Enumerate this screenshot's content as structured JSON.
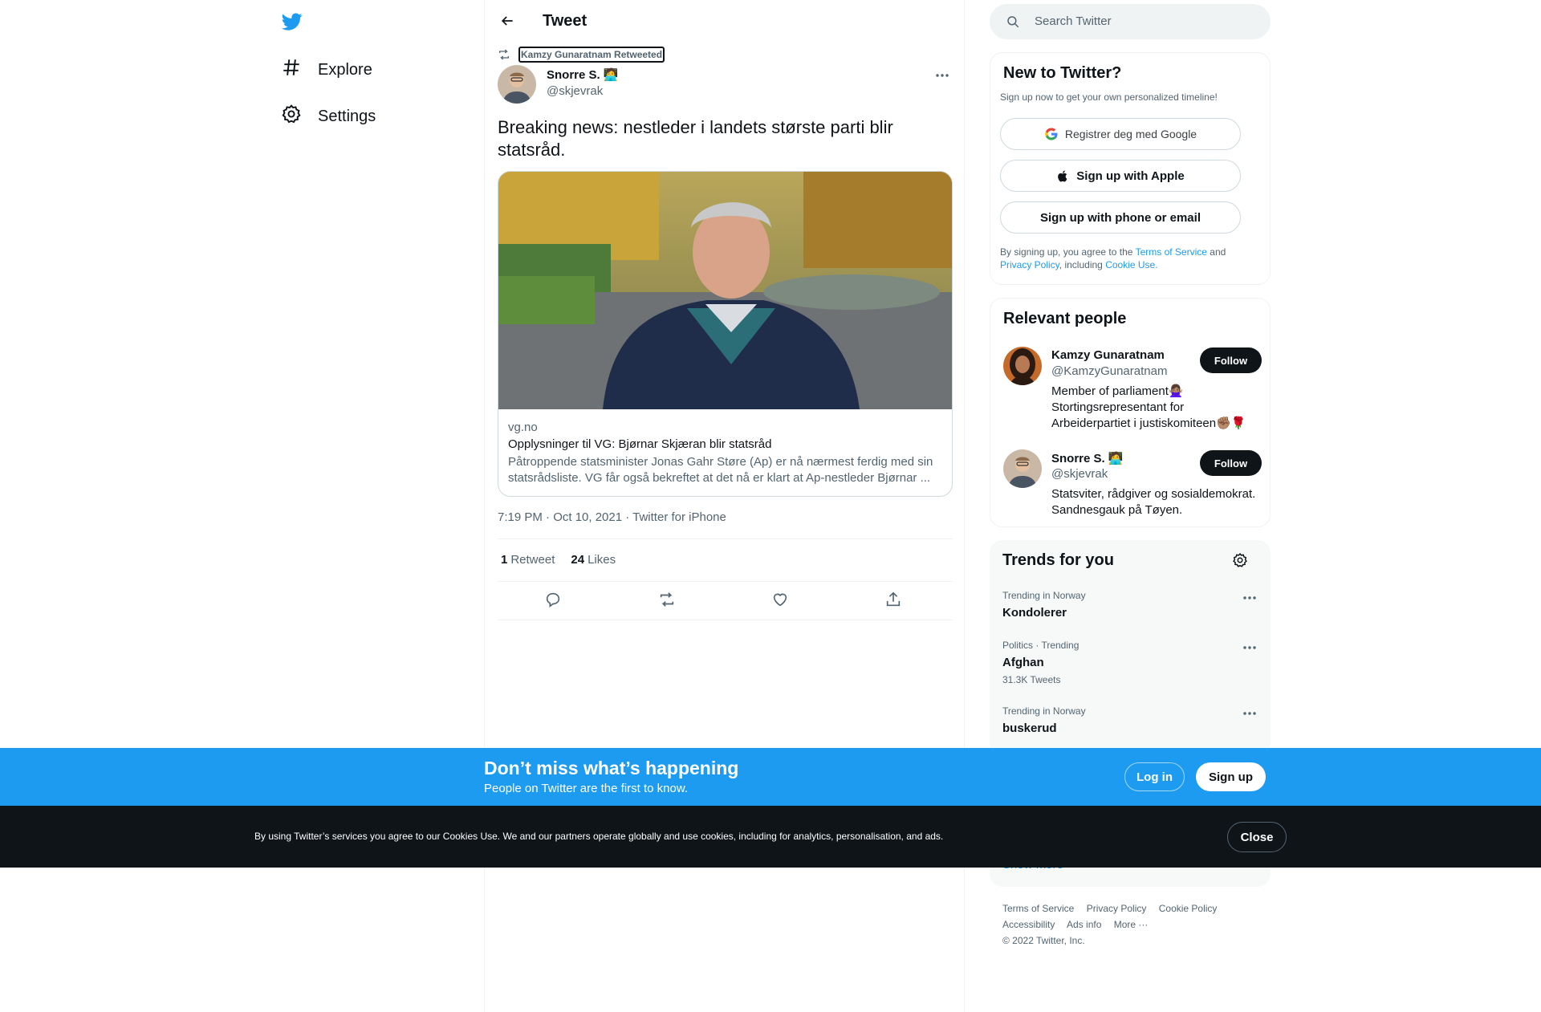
{
  "nav": {
    "items": [
      {
        "label": "Explore",
        "icon": "hashtag-icon"
      },
      {
        "label": "Settings",
        "icon": "gear-icon"
      }
    ]
  },
  "header": {
    "title": "Tweet"
  },
  "tweet": {
    "retweeted_by": "Kamzy Gunaratnam Retweeted",
    "author_name": "Snorre S. 🧑‍💻",
    "author_handle": "@skjevrak",
    "text": "Breaking news: nestleder i landets største parti blir statsråd.",
    "card": {
      "domain": "vg.no",
      "title": "Opplysninger til VG: Bjørnar Skjæran blir statsråd",
      "description": "Påtroppende statsminister Jonas Gahr Støre (Ap) er nå nærmest ferdig med sin statsrådsliste. VG får også bekreftet at det nå er klart at Ap-nestleder Bjørnar ..."
    },
    "timestamp": "7:19 PM · Oct 10, 2021 · Twitter for iPhone",
    "retweet_count": "1",
    "retweet_label": "Retweet",
    "like_count": "24",
    "like_label": "Likes"
  },
  "search": {
    "placeholder": "Search Twitter"
  },
  "new_to_twitter": {
    "title": "New to Twitter?",
    "subtitle": "Sign up now to get your own personalized timeline!",
    "google_label": "Registrer deg med Google",
    "apple_label": "Sign up with Apple",
    "phone_label": "Sign up with phone or email",
    "legal_prefix": "By signing up, you agree to the",
    "terms_link": "Terms of Service",
    "and": "and",
    "privacy_link": "Privacy Policy",
    "including": ", including",
    "cookie_link": "Cookie Use."
  },
  "relevant_people": {
    "title": "Relevant people",
    "people": [
      {
        "name": "Kamzy Gunaratnam",
        "handle": "@KamzyGunaratnam",
        "bio": "Member of parliament🙅🏽‍♀️ Stortingsrepresentant for Arbeiderpartiet i justiskomiteen✊🏽🌹",
        "follow_label": "Follow"
      },
      {
        "name": "Snorre S. 🧑‍💻",
        "handle": "@skjevrak",
        "bio": "Statsviter, rådgiver og sosialdemokrat. Sandnesgauk på Tøyen.",
        "follow_label": "Follow"
      }
    ]
  },
  "trends": {
    "title": "Trends for you",
    "items": [
      {
        "meta": "Trending in Norway",
        "name": "Kondolerer",
        "count": ""
      },
      {
        "meta": "Politics · Trending",
        "name": "Afghan",
        "count": "31.3K Tweets"
      },
      {
        "meta": "Trending in Norway",
        "name": "buskerud",
        "count": ""
      }
    ],
    "show_more": "Show more"
  },
  "footer": {
    "links": [
      "Terms of Service",
      "Privacy Policy",
      "Cookie Policy",
      "Accessibility",
      "Ads info",
      "More ···"
    ],
    "copyright": "© 2022 Twitter, Inc."
  },
  "signup_bar": {
    "title": "Don’t miss what’s happening",
    "subtitle": "People on Twitter are the first to know.",
    "login_label": "Log in",
    "signup_label": "Sign up"
  },
  "cookie_bar": {
    "text": "By using Twitter’s services you agree to our Cookies Use. We and our partners operate globally and use cookies, including for analytics, personalisation, and ads.",
    "close_label": "Close"
  },
  "colors": {
    "accent": "#1d9bf0",
    "text": "#0f1419",
    "muted": "#536471",
    "cookie_bg": "#0f1419"
  }
}
